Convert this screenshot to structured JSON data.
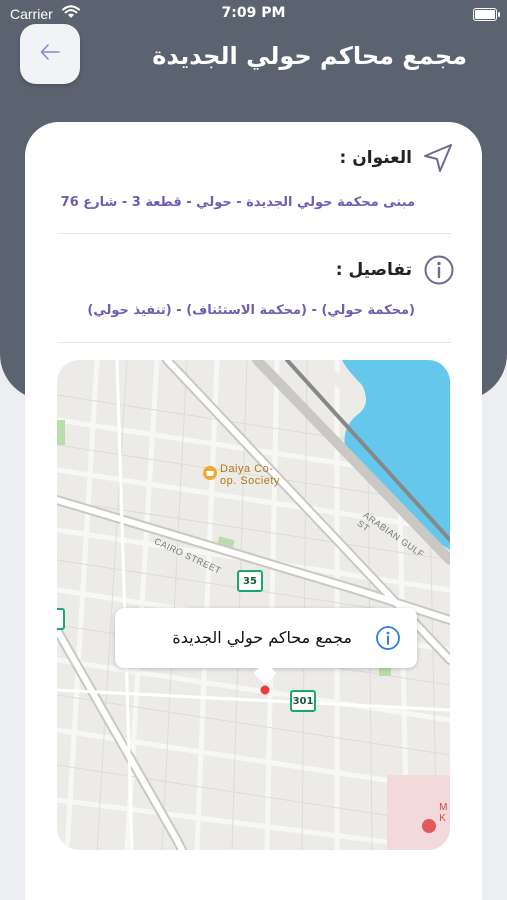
{
  "status_bar": {
    "carrier": "Carrier",
    "time": "7:09 PM"
  },
  "header": {
    "title": "مجمع محاكم حولي الجديدة"
  },
  "address": {
    "label": "العنوان :",
    "value": "مبنى محكمة حولي الجديدة - حولي - قطعة 3 - شارع 76"
  },
  "details": {
    "label": "تفاصيل :",
    "value": "(محكمة حولي) - (محكمة الاستئناف) - (تنفيذ حولي)"
  },
  "map": {
    "callout_name": "مجمع محاكم حولي الجديدة",
    "poi_line1": "Daiya Co-",
    "poi_line2": "op. Society",
    "street_cairo": "CAIRO STREET",
    "street_arabian": "ARABIAN GULF ST",
    "shield_35": "35",
    "shield_301": "301",
    "edge_text_1": "M",
    "edge_text_2": "K"
  },
  "colors": {
    "header": "#5c6370",
    "accent": "#6b5fb4",
    "map_water": "#64c8ec",
    "map_land": "#ecebe7"
  }
}
